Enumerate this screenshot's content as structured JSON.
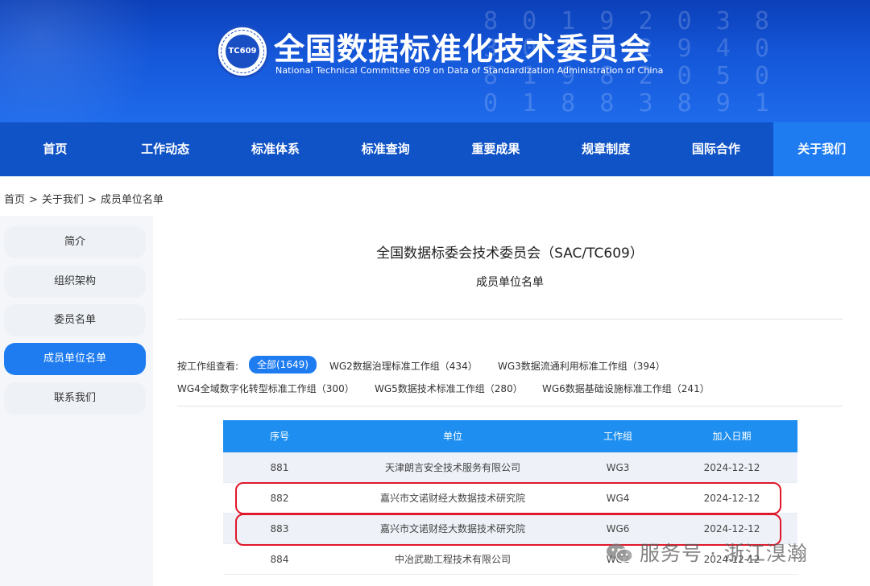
{
  "banner": {
    "logo_text": "TC609",
    "title": "全国数据标准化技术委员会",
    "subtitle": "National Technical Committee 609 on Data of Standardization Administration of China",
    "deco_digits": "8 0 1 9 2 0 3 8\n3 0 8 1 2 9 4 0\n8 1 9 8 2 0 5 0\n0 1 8 8 3 8 9 1"
  },
  "nav": {
    "items": [
      "首页",
      "工作动态",
      "标准体系",
      "标准查询",
      "重要成果",
      "规章制度",
      "国际合作",
      "关于我们"
    ],
    "active_index": 7
  },
  "breadcrumb": [
    "首页",
    "关于我们",
    "成员单位名单"
  ],
  "breadcrumb_sep": ">",
  "sidebar": {
    "items": [
      "简介",
      "组织架构",
      "委员名单",
      "成员单位名单",
      "联系我们"
    ],
    "active_index": 3
  },
  "content": {
    "title": "全国数据标委会技术委员会（SAC/TC609）",
    "subtitle": "成员单位名单",
    "filter_label": "按工作组查看:",
    "filters": [
      "全部(1649)",
      "WG2数据治理标准工作组（434）",
      "WG3数据流通利用标准工作组（394）",
      "WG4全域数字化转型标准工作组（300）",
      "WG5数据技术标准工作组（280）",
      "WG6数据基础设施标准工作组（241）"
    ],
    "active_filter": 0
  },
  "table": {
    "headers": [
      "序号",
      "单位",
      "工作组",
      "加入日期"
    ],
    "rows": [
      [
        "881",
        "天津朗言安全技术服务有限公司",
        "WG3",
        "2024-12-12"
      ],
      [
        "882",
        "嘉兴市文诺财经大数据技术研究院",
        "WG4",
        "2024-12-12"
      ],
      [
        "883",
        "嘉兴市文诺财经大数据技术研究院",
        "WG6",
        "2024-12-12"
      ],
      [
        "884",
        "中冶武勘工程技术有限公司",
        "WG2",
        "2024-12-12"
      ]
    ]
  },
  "watermark": "服务号 · 浙江湨瀚",
  "colors": {
    "nav_bg": "#1053c6",
    "nav_active": "#1e7cf0",
    "table_header": "#1e8ff0",
    "highlight": "#e0182b"
  }
}
